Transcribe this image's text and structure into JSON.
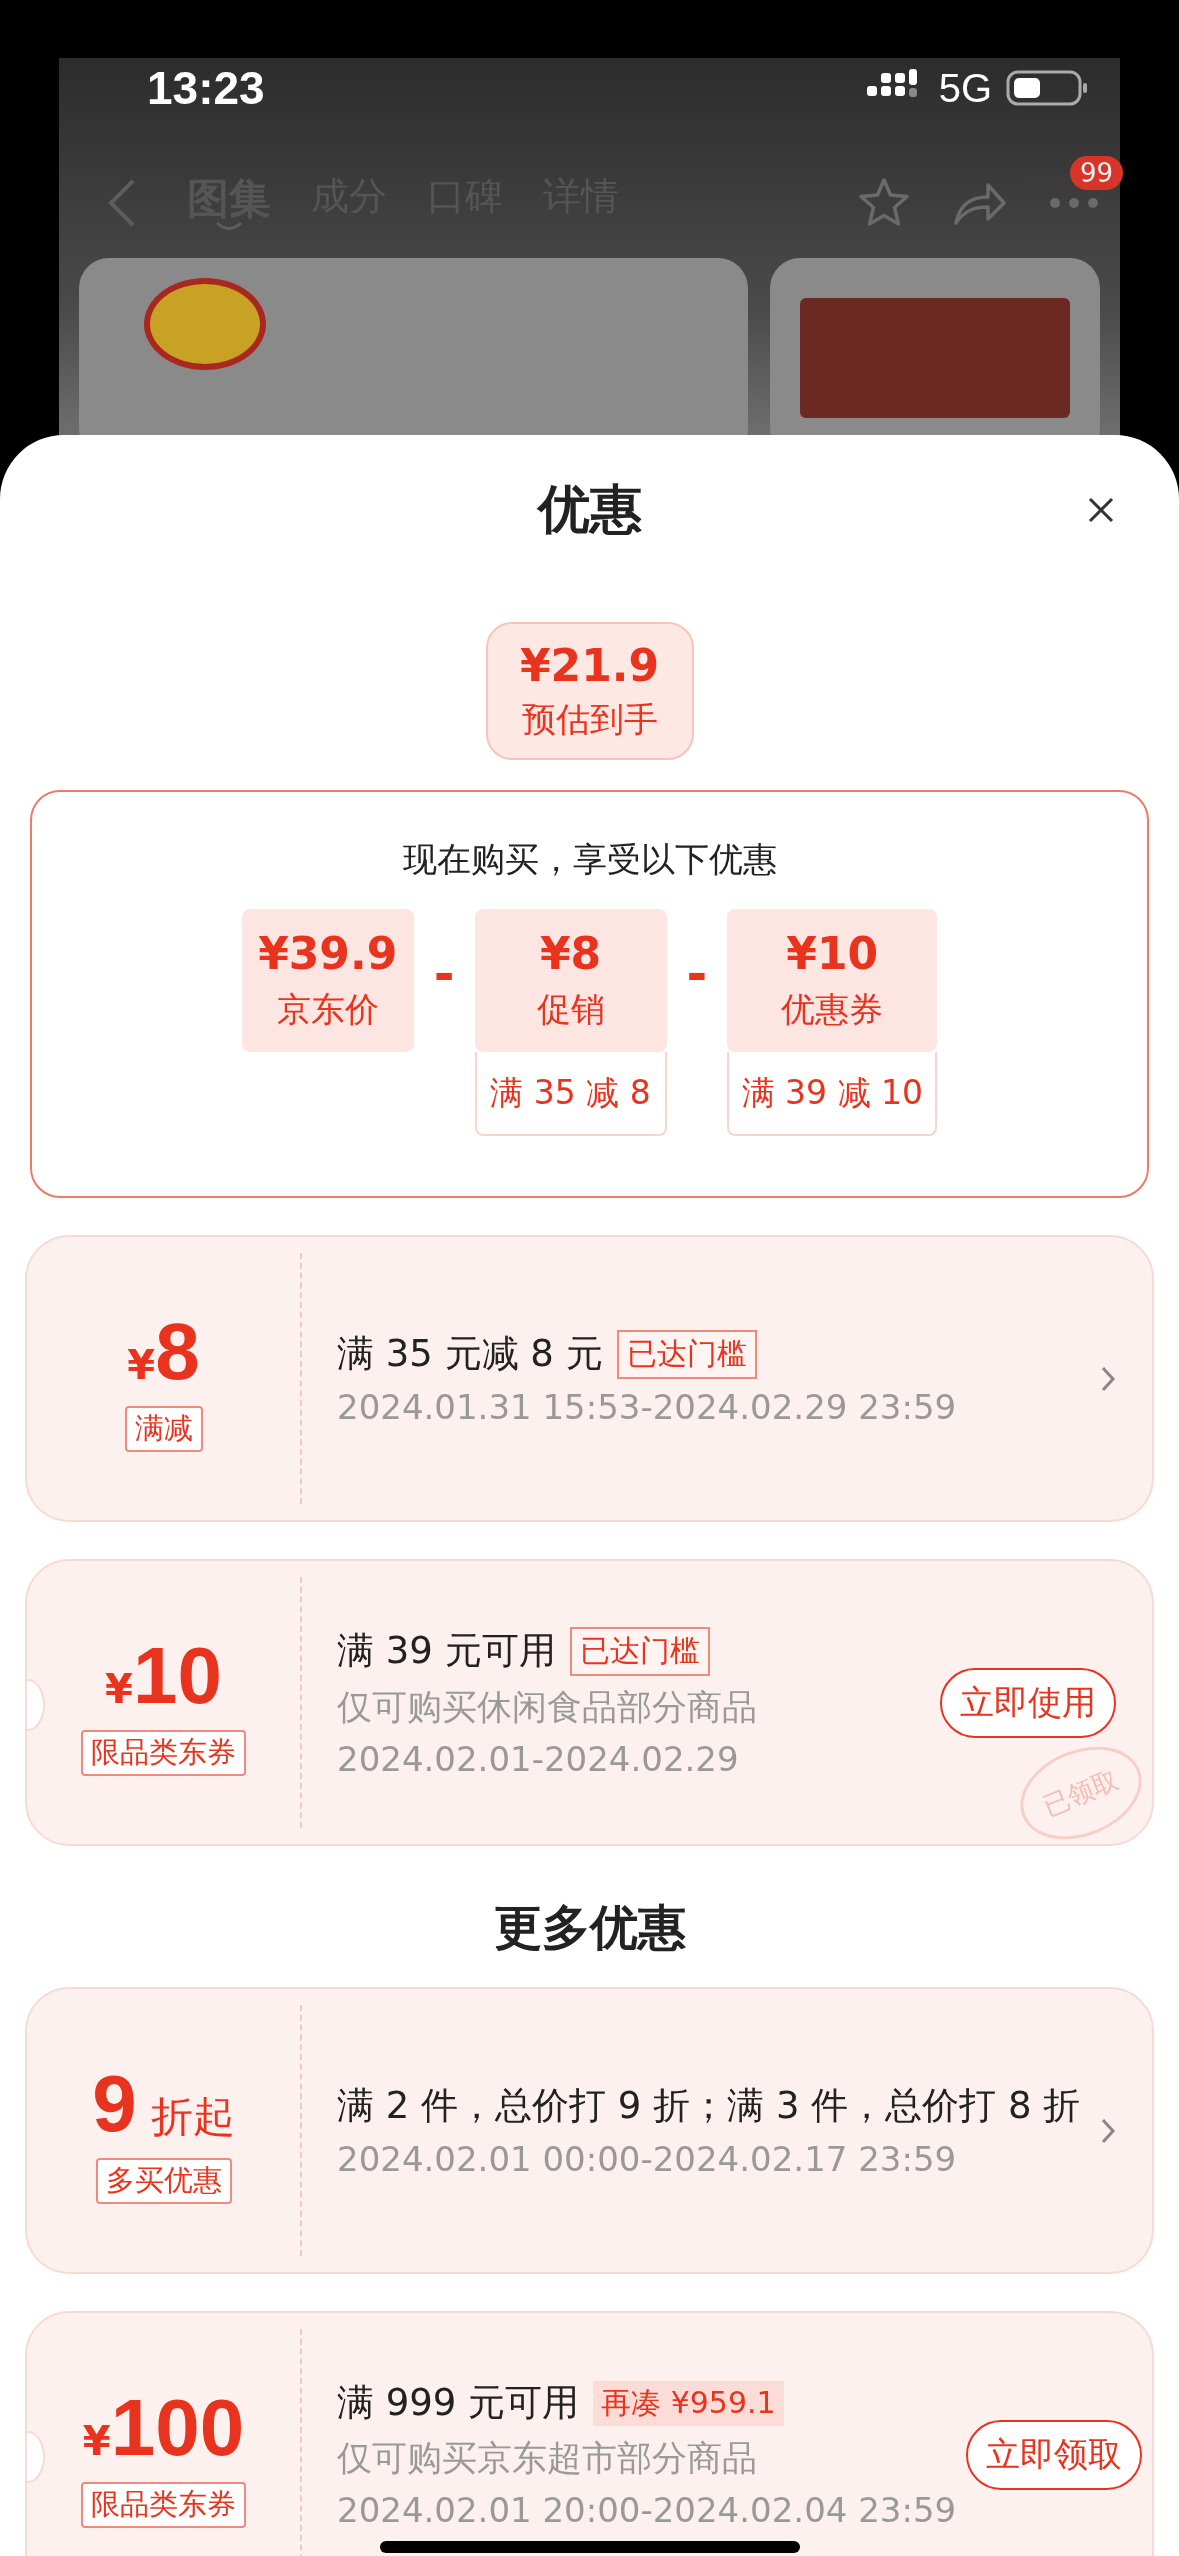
{
  "status_bar": {
    "time": "13:23",
    "network": "5G"
  },
  "nav": {
    "tabs": [
      {
        "label": "图集",
        "selected": true
      },
      {
        "label": "成分",
        "selected": false
      },
      {
        "label": "口碑",
        "selected": false
      },
      {
        "label": "详情",
        "selected": false
      }
    ],
    "more_badge": "99"
  },
  "sheet": {
    "title": "优惠"
  },
  "estimate": {
    "price": "¥21.9",
    "label": "预估到手"
  },
  "breakdown": {
    "heading": "现在购买，享受以下优惠",
    "items": [
      {
        "price": "¥39.9",
        "label": "京东价"
      },
      {
        "operator": "-",
        "price": "¥8",
        "label": "促销",
        "condition": "满 35 减 8"
      },
      {
        "operator": "-",
        "price": "¥10",
        "label": "优惠券",
        "condition": "满 39 减 10"
      }
    ]
  },
  "coupons": [
    {
      "kind": "plain",
      "currency": "¥",
      "amount": "8",
      "tag": "满减",
      "title": "满 35 元减 8 元",
      "status": {
        "kind": "outline",
        "text": "已达门槛"
      },
      "dates": "2024.01.31 15:53-2024.02.29 23:59",
      "action": {
        "kind": "chevron"
      }
    },
    {
      "kind": "ticket",
      "currency": "¥",
      "amount": "10",
      "tag": "限品类东券",
      "title": "满 39 元可用",
      "status": {
        "kind": "outline",
        "text": "已达门槛"
      },
      "note": "仅可购买休闲食品部分商品",
      "dates": "2024.02.01-2024.02.29",
      "action": {
        "kind": "button",
        "label": "立即使用"
      },
      "stamp": "已领取"
    }
  ],
  "more": {
    "heading": "更多优惠",
    "coupons": [
      {
        "kind": "plain",
        "amount": "9",
        "suffix": "折起",
        "tag": "多买优惠",
        "title": "满 2 件，总价打 9 折；满 3 件，总价打 8 折",
        "dates": "2024.02.01 00:00-2024.02.17 23:59",
        "action": {
          "kind": "chevron"
        }
      },
      {
        "kind": "ticket",
        "currency": "¥",
        "amount": "100",
        "tag": "限品类东券",
        "title": "满 999 元可用",
        "status": {
          "kind": "filled",
          "text": "再凑 ¥959.1"
        },
        "note": "仅可购买京东超市部分商品",
        "dates": "2024.02.01 20:00-2024.02.04 23:59",
        "action": {
          "kind": "button",
          "label": "立即领取"
        }
      }
    ]
  }
}
